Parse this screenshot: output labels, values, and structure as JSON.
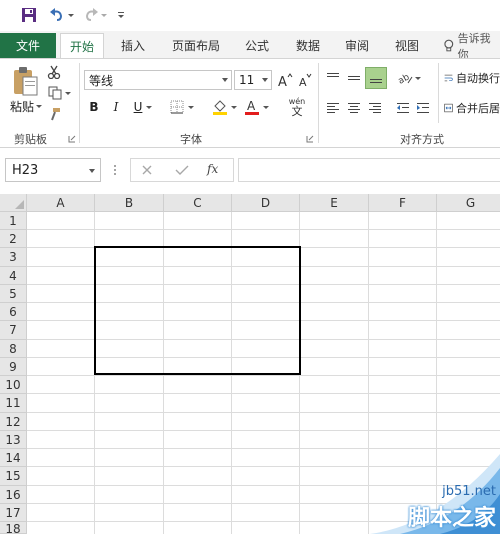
{
  "ribbon_tabs": [
    {
      "label": "文件",
      "active": false
    },
    {
      "label": "开始",
      "active": true
    },
    {
      "label": "插入",
      "active": false
    },
    {
      "label": "页面布局",
      "active": false
    },
    {
      "label": "公式",
      "active": false
    },
    {
      "label": "数据",
      "active": false
    },
    {
      "label": "审阅",
      "active": false
    },
    {
      "label": "视图",
      "active": false
    }
  ],
  "tell_me": "告诉我你",
  "clipboard": {
    "paste_label": "粘贴",
    "group_label": "剪贴板"
  },
  "font": {
    "name": "等线",
    "size": "11",
    "group_label": "字体",
    "wen_label": "wén",
    "wen_char": "文",
    "fill_color": "#ffd200",
    "font_color": "#e21d1d"
  },
  "alignment": {
    "wrap_label": "自动换行",
    "merge_label": "合并后居",
    "group_label": "对齐方式"
  },
  "formula_bar": {
    "name_box": "H23",
    "fx": "fx",
    "formula": ""
  },
  "columns": [
    "A",
    "B",
    "C",
    "D",
    "E",
    "F",
    "G"
  ],
  "rows": [
    "1",
    "2",
    "3",
    "4",
    "5",
    "6",
    "7",
    "8",
    "9",
    "10",
    "11",
    "12",
    "13",
    "14",
    "15",
    "16",
    "17",
    "18"
  ],
  "watermark": {
    "site": "jb51.net",
    "name": "脚本之家"
  },
  "colors": {
    "excel_green": "#217346",
    "header_bg": "#e6e6e6",
    "gridline": "#dcdcdc"
  }
}
